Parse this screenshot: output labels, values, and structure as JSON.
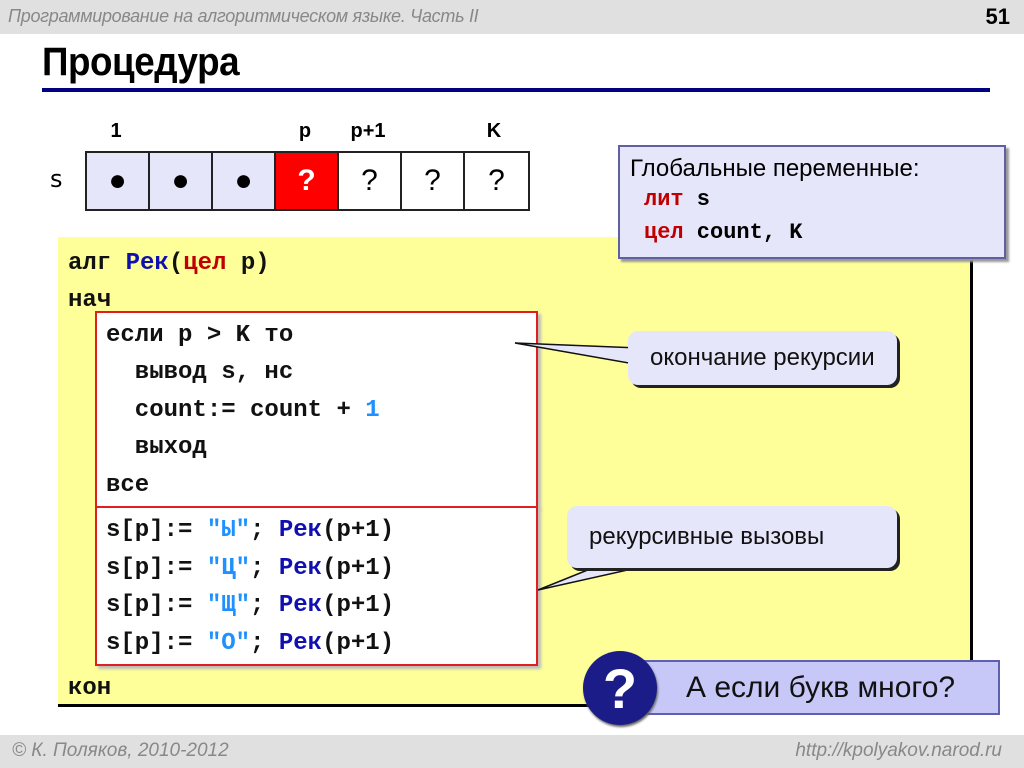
{
  "header": {
    "subtitle": "Программирование на алгоритмическом языке. Часть II",
    "page_number": "51"
  },
  "title": "Процедура",
  "array_diagram": {
    "name": "s",
    "index_labels": [
      {
        "text": "1",
        "cell": 0
      },
      {
        "text": "p",
        "cell": 3
      },
      {
        "text": "p+1",
        "cell": 4
      },
      {
        "text": "K",
        "cell": 6
      }
    ],
    "cells": [
      {
        "value": "●",
        "state": "filled"
      },
      {
        "value": "●",
        "state": "filled"
      },
      {
        "value": "●",
        "state": "filled"
      },
      {
        "value": "?",
        "state": "current"
      },
      {
        "value": "?",
        "state": "empty"
      },
      {
        "value": "?",
        "state": "empty"
      },
      {
        "value": "?",
        "state": "empty"
      }
    ],
    "colors": {
      "filled": "#e6e6fa",
      "current": "#ff0000",
      "empty": "#ffffff"
    }
  },
  "globals": {
    "heading": "Глобальные переменные:",
    "lines": [
      {
        "kw": "лит",
        "rest": " s"
      },
      {
        "kw": "цел",
        "rest": " count, K"
      }
    ]
  },
  "code": {
    "header": {
      "kw1": "алг ",
      "name": "Рек",
      "open": "(",
      "kw2": "цел",
      "rest": " p)"
    },
    "begin": "нач",
    "if_block": [
      "если p > K то",
      "  вывод s, нс",
      "  count:= count + ",
      "  выход",
      "все"
    ],
    "increment_literal": "1",
    "calls": [
      {
        "lhs": "s[p]:= ",
        "literal": "\"Ы\"",
        "sep": "; ",
        "proc": "Рек",
        "args": "(p+1)"
      },
      {
        "lhs": "s[p]:= ",
        "literal": "\"Ц\"",
        "sep": "; ",
        "proc": "Рек",
        "args": "(p+1)"
      },
      {
        "lhs": "s[p]:= ",
        "literal": "\"Щ\"",
        "sep": "; ",
        "proc": "Рек",
        "args": "(p+1)"
      },
      {
        "lhs": "s[p]:= ",
        "literal": "\"О\"",
        "sep": "; ",
        "proc": "Рек",
        "args": "(p+1)"
      }
    ],
    "end": "кон"
  },
  "callouts": {
    "recursion_end": "окончание рекурсии",
    "recursive_calls": "рекурсивные вызовы"
  },
  "question": {
    "icon": "question-icon",
    "text": "А если букв много?"
  },
  "footer": {
    "copyright": "© К. Поляков, 2010-2012",
    "url": "http://kpolyakov.narod.ru"
  },
  "colors": {
    "title_rule": "#000080",
    "code_background": "#ffff99",
    "keyword_red": "#c00000",
    "procedure_blue": "#1010b0",
    "literal_cyan": "#1e90ff",
    "callout_bg": "#e6e6fa",
    "block_border": "#e02020"
  }
}
